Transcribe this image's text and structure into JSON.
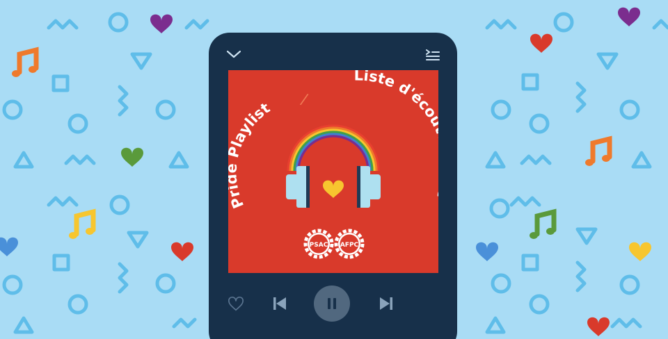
{
  "player": {
    "cover": {
      "title_en": "Pride Playlist",
      "separator": "/",
      "title_fr": "Liste d'écoute Fierté",
      "logo_left": "PSAC",
      "logo_right": "AFPC"
    },
    "state": "playing",
    "icons": {
      "collapse": "chevron-down-icon",
      "queue": "queue-list-icon",
      "like": "heart-outline-icon",
      "previous": "skip-previous-icon",
      "pause": "pause-icon",
      "next": "skip-next-icon"
    }
  },
  "colors": {
    "background": "#a9dcf5",
    "pattern": "#5fbde9",
    "phone": "#17304a",
    "cover": "#d93a2b",
    "heart_yellow": "#f7c62f"
  }
}
